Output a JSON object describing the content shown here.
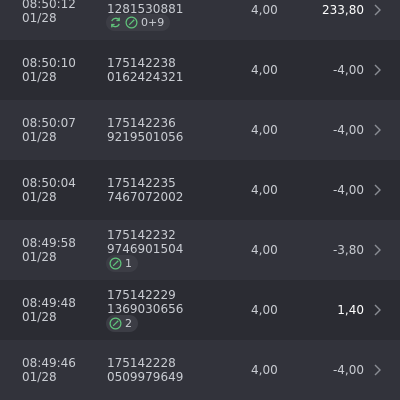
{
  "rows": [
    {
      "time": "08:50:12",
      "date": "01/28",
      "id1": "",
      "id2": "1281530881",
      "stake": "4,00",
      "amount": "233,80",
      "positive": true,
      "badge": {
        "icons": [
          "refresh-icon",
          "bet-icon"
        ],
        "text": "0+9"
      }
    },
    {
      "time": "08:50:10",
      "date": "01/28",
      "id1": "175142238",
      "id2": "0162424321",
      "stake": "4,00",
      "amount": "-4,00",
      "positive": false,
      "badge": null
    },
    {
      "time": "08:50:07",
      "date": "01/28",
      "id1": "175142236",
      "id2": "9219501056",
      "stake": "4,00",
      "amount": "-4,00",
      "positive": false,
      "badge": null
    },
    {
      "time": "08:50:04",
      "date": "01/28",
      "id1": "175142235",
      "id2": "7467072002",
      "stake": "4,00",
      "amount": "-4,00",
      "positive": false,
      "badge": null
    },
    {
      "time": "08:49:58",
      "date": "01/28",
      "id1": "175142232",
      "id2": "9746901504",
      "stake": "4,00",
      "amount": "-3,80",
      "positive": false,
      "badge": {
        "icons": [
          "bet-icon"
        ],
        "text": "1"
      }
    },
    {
      "time": "08:49:48",
      "date": "01/28",
      "id1": "175142229",
      "id2": "1369030656",
      "stake": "4,00",
      "amount": "1,40",
      "positive": true,
      "badge": {
        "icons": [
          "bet-icon"
        ],
        "text": "2"
      }
    },
    {
      "time": "08:49:46",
      "date": "01/28",
      "id1": "175142228",
      "id2": "0509979649",
      "stake": "4,00",
      "amount": "-4,00",
      "positive": false,
      "badge": null
    }
  ],
  "colors": {
    "accent": "#5fc27a",
    "background": "#2b2c33",
    "row_alt": "#32333b"
  }
}
